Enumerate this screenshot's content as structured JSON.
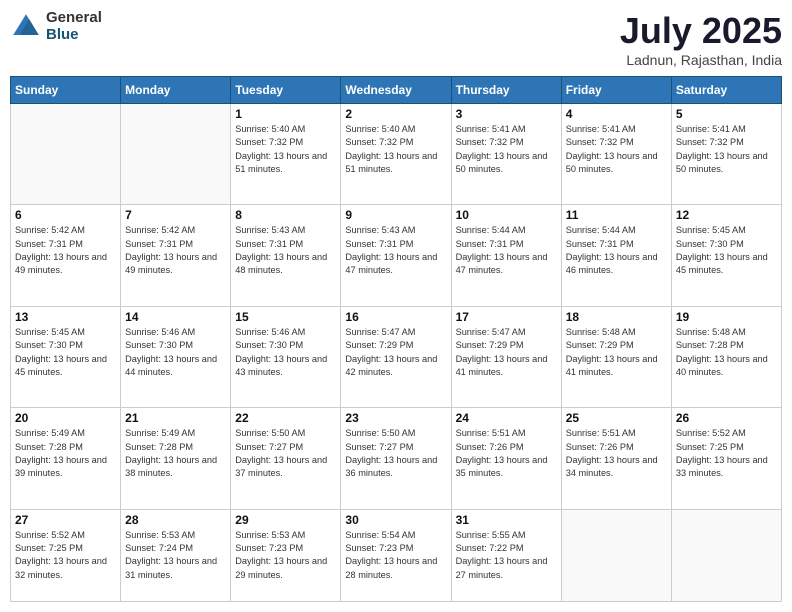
{
  "logo": {
    "general": "General",
    "blue": "Blue"
  },
  "header": {
    "title": "July 2025",
    "location": "Ladnun, Rajasthan, India"
  },
  "weekdays": [
    "Sunday",
    "Monday",
    "Tuesday",
    "Wednesday",
    "Thursday",
    "Friday",
    "Saturday"
  ],
  "weeks": [
    [
      {
        "day": "",
        "sunrise": "",
        "sunset": "",
        "daylight": ""
      },
      {
        "day": "",
        "sunrise": "",
        "sunset": "",
        "daylight": ""
      },
      {
        "day": "1",
        "sunrise": "Sunrise: 5:40 AM",
        "sunset": "Sunset: 7:32 PM",
        "daylight": "Daylight: 13 hours and 51 minutes."
      },
      {
        "day": "2",
        "sunrise": "Sunrise: 5:40 AM",
        "sunset": "Sunset: 7:32 PM",
        "daylight": "Daylight: 13 hours and 51 minutes."
      },
      {
        "day": "3",
        "sunrise": "Sunrise: 5:41 AM",
        "sunset": "Sunset: 7:32 PM",
        "daylight": "Daylight: 13 hours and 50 minutes."
      },
      {
        "day": "4",
        "sunrise": "Sunrise: 5:41 AM",
        "sunset": "Sunset: 7:32 PM",
        "daylight": "Daylight: 13 hours and 50 minutes."
      },
      {
        "day": "5",
        "sunrise": "Sunrise: 5:41 AM",
        "sunset": "Sunset: 7:32 PM",
        "daylight": "Daylight: 13 hours and 50 minutes."
      }
    ],
    [
      {
        "day": "6",
        "sunrise": "Sunrise: 5:42 AM",
        "sunset": "Sunset: 7:31 PM",
        "daylight": "Daylight: 13 hours and 49 minutes."
      },
      {
        "day": "7",
        "sunrise": "Sunrise: 5:42 AM",
        "sunset": "Sunset: 7:31 PM",
        "daylight": "Daylight: 13 hours and 49 minutes."
      },
      {
        "day": "8",
        "sunrise": "Sunrise: 5:43 AM",
        "sunset": "Sunset: 7:31 PM",
        "daylight": "Daylight: 13 hours and 48 minutes."
      },
      {
        "day": "9",
        "sunrise": "Sunrise: 5:43 AM",
        "sunset": "Sunset: 7:31 PM",
        "daylight": "Daylight: 13 hours and 47 minutes."
      },
      {
        "day": "10",
        "sunrise": "Sunrise: 5:44 AM",
        "sunset": "Sunset: 7:31 PM",
        "daylight": "Daylight: 13 hours and 47 minutes."
      },
      {
        "day": "11",
        "sunrise": "Sunrise: 5:44 AM",
        "sunset": "Sunset: 7:31 PM",
        "daylight": "Daylight: 13 hours and 46 minutes."
      },
      {
        "day": "12",
        "sunrise": "Sunrise: 5:45 AM",
        "sunset": "Sunset: 7:30 PM",
        "daylight": "Daylight: 13 hours and 45 minutes."
      }
    ],
    [
      {
        "day": "13",
        "sunrise": "Sunrise: 5:45 AM",
        "sunset": "Sunset: 7:30 PM",
        "daylight": "Daylight: 13 hours and 45 minutes."
      },
      {
        "day": "14",
        "sunrise": "Sunrise: 5:46 AM",
        "sunset": "Sunset: 7:30 PM",
        "daylight": "Daylight: 13 hours and 44 minutes."
      },
      {
        "day": "15",
        "sunrise": "Sunrise: 5:46 AM",
        "sunset": "Sunset: 7:30 PM",
        "daylight": "Daylight: 13 hours and 43 minutes."
      },
      {
        "day": "16",
        "sunrise": "Sunrise: 5:47 AM",
        "sunset": "Sunset: 7:29 PM",
        "daylight": "Daylight: 13 hours and 42 minutes."
      },
      {
        "day": "17",
        "sunrise": "Sunrise: 5:47 AM",
        "sunset": "Sunset: 7:29 PM",
        "daylight": "Daylight: 13 hours and 41 minutes."
      },
      {
        "day": "18",
        "sunrise": "Sunrise: 5:48 AM",
        "sunset": "Sunset: 7:29 PM",
        "daylight": "Daylight: 13 hours and 41 minutes."
      },
      {
        "day": "19",
        "sunrise": "Sunrise: 5:48 AM",
        "sunset": "Sunset: 7:28 PM",
        "daylight": "Daylight: 13 hours and 40 minutes."
      }
    ],
    [
      {
        "day": "20",
        "sunrise": "Sunrise: 5:49 AM",
        "sunset": "Sunset: 7:28 PM",
        "daylight": "Daylight: 13 hours and 39 minutes."
      },
      {
        "day": "21",
        "sunrise": "Sunrise: 5:49 AM",
        "sunset": "Sunset: 7:28 PM",
        "daylight": "Daylight: 13 hours and 38 minutes."
      },
      {
        "day": "22",
        "sunrise": "Sunrise: 5:50 AM",
        "sunset": "Sunset: 7:27 PM",
        "daylight": "Daylight: 13 hours and 37 minutes."
      },
      {
        "day": "23",
        "sunrise": "Sunrise: 5:50 AM",
        "sunset": "Sunset: 7:27 PM",
        "daylight": "Daylight: 13 hours and 36 minutes."
      },
      {
        "day": "24",
        "sunrise": "Sunrise: 5:51 AM",
        "sunset": "Sunset: 7:26 PM",
        "daylight": "Daylight: 13 hours and 35 minutes."
      },
      {
        "day": "25",
        "sunrise": "Sunrise: 5:51 AM",
        "sunset": "Sunset: 7:26 PM",
        "daylight": "Daylight: 13 hours and 34 minutes."
      },
      {
        "day": "26",
        "sunrise": "Sunrise: 5:52 AM",
        "sunset": "Sunset: 7:25 PM",
        "daylight": "Daylight: 13 hours and 33 minutes."
      }
    ],
    [
      {
        "day": "27",
        "sunrise": "Sunrise: 5:52 AM",
        "sunset": "Sunset: 7:25 PM",
        "daylight": "Daylight: 13 hours and 32 minutes."
      },
      {
        "day": "28",
        "sunrise": "Sunrise: 5:53 AM",
        "sunset": "Sunset: 7:24 PM",
        "daylight": "Daylight: 13 hours and 31 minutes."
      },
      {
        "day": "29",
        "sunrise": "Sunrise: 5:53 AM",
        "sunset": "Sunset: 7:23 PM",
        "daylight": "Daylight: 13 hours and 29 minutes."
      },
      {
        "day": "30",
        "sunrise": "Sunrise: 5:54 AM",
        "sunset": "Sunset: 7:23 PM",
        "daylight": "Daylight: 13 hours and 28 minutes."
      },
      {
        "day": "31",
        "sunrise": "Sunrise: 5:55 AM",
        "sunset": "Sunset: 7:22 PM",
        "daylight": "Daylight: 13 hours and 27 minutes."
      },
      {
        "day": "",
        "sunrise": "",
        "sunset": "",
        "daylight": ""
      },
      {
        "day": "",
        "sunrise": "",
        "sunset": "",
        "daylight": ""
      }
    ]
  ]
}
